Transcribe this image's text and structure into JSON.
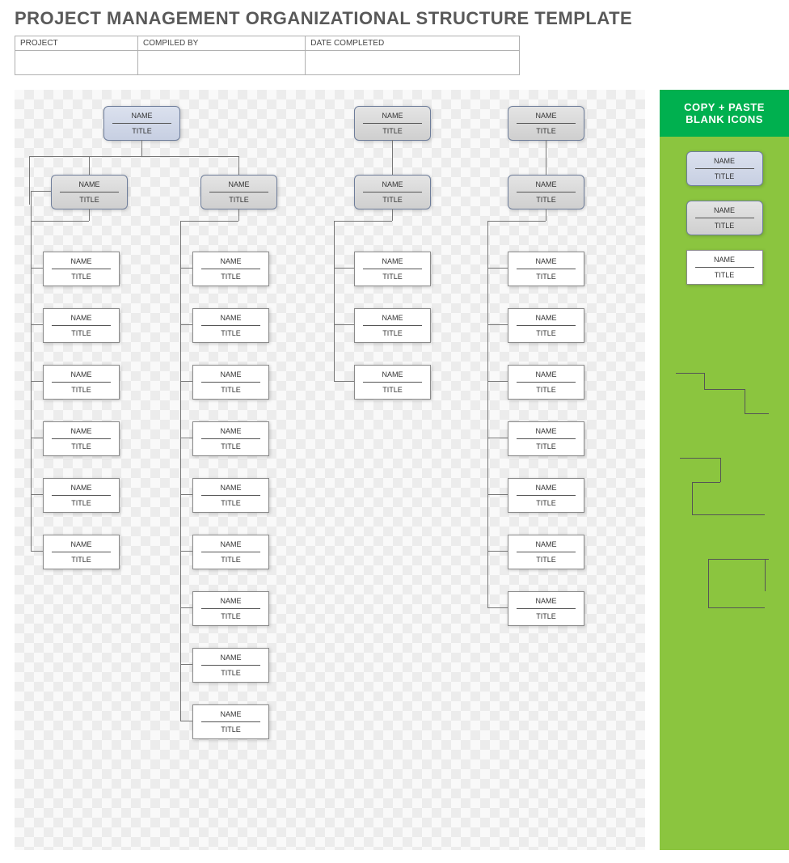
{
  "title": "PROJECT MANAGEMENT ORGANIZATIONAL STRUCTURE TEMPLATE",
  "meta": {
    "labels": {
      "project": "PROJECT",
      "compiled_by": "COMPILED BY",
      "date_completed": "DATE COMPLETED"
    },
    "values": {
      "project": "",
      "compiled_by": "",
      "date_completed": ""
    }
  },
  "placeholders": {
    "name": "NAME",
    "title": "TITLE"
  },
  "sidebar": {
    "header_line1": "COPY + PASTE",
    "header_line2": "BLANK ICONS"
  },
  "org": {
    "root": {
      "name": "NAME",
      "title": "TITLE",
      "style": "blue"
    },
    "level2": [
      {
        "name": "NAME",
        "title": "TITLE",
        "style": "gray"
      },
      {
        "name": "NAME",
        "title": "TITLE",
        "style": "gray"
      }
    ],
    "column1": [
      {
        "name": "NAME",
        "title": "TITLE"
      },
      {
        "name": "NAME",
        "title": "TITLE"
      },
      {
        "name": "NAME",
        "title": "TITLE"
      },
      {
        "name": "NAME",
        "title": "TITLE"
      },
      {
        "name": "NAME",
        "title": "TITLE"
      },
      {
        "name": "NAME",
        "title": "TITLE"
      }
    ],
    "column2": [
      {
        "name": "NAME",
        "title": "TITLE"
      },
      {
        "name": "NAME",
        "title": "TITLE"
      },
      {
        "name": "NAME",
        "title": "TITLE"
      },
      {
        "name": "NAME",
        "title": "TITLE"
      },
      {
        "name": "NAME",
        "title": "TITLE"
      },
      {
        "name": "NAME",
        "title": "TITLE"
      },
      {
        "name": "NAME",
        "title": "TITLE"
      },
      {
        "name": "NAME",
        "title": "TITLE"
      },
      {
        "name": "NAME",
        "title": "TITLE"
      }
    ],
    "branch3": {
      "top": {
        "name": "NAME",
        "title": "TITLE",
        "style": "gray"
      },
      "mid": {
        "name": "NAME",
        "title": "TITLE",
        "style": "gray"
      },
      "leaves": [
        {
          "name": "NAME",
          "title": "TITLE"
        },
        {
          "name": "NAME",
          "title": "TITLE"
        },
        {
          "name": "NAME",
          "title": "TITLE"
        }
      ]
    },
    "branch4": {
      "top": {
        "name": "NAME",
        "title": "TITLE",
        "style": "gray"
      },
      "mid": {
        "name": "NAME",
        "title": "TITLE",
        "style": "gray"
      },
      "leaves": [
        {
          "name": "NAME",
          "title": "TITLE"
        },
        {
          "name": "NAME",
          "title": "TITLE"
        },
        {
          "name": "NAME",
          "title": "TITLE"
        },
        {
          "name": "NAME",
          "title": "TITLE"
        },
        {
          "name": "NAME",
          "title": "TITLE"
        },
        {
          "name": "NAME",
          "title": "TITLE"
        },
        {
          "name": "NAME",
          "title": "TITLE"
        }
      ]
    }
  },
  "sidebar_nodes": [
    {
      "name": "NAME",
      "title": "TITLE",
      "style": "blue"
    },
    {
      "name": "NAME",
      "title": "TITLE",
      "style": "gray"
    },
    {
      "name": "NAME",
      "title": "TITLE",
      "style": "white"
    }
  ]
}
